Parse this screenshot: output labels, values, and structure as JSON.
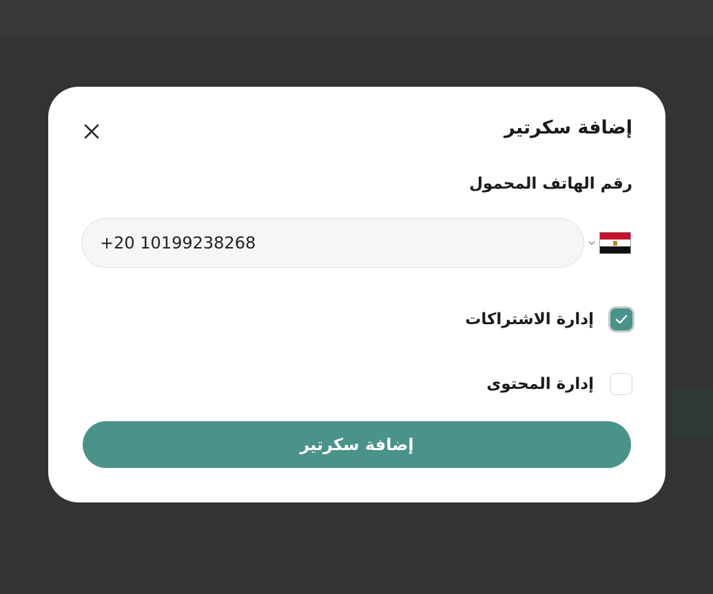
{
  "modal": {
    "title": "إضافة سكرتير",
    "phone_label": "رقم الهاتف المحمول",
    "phone_value": "+20 10199238268",
    "country": "Egypt",
    "permissions": [
      {
        "label": "إدارة الاشتراكات",
        "checked": true
      },
      {
        "label": "إدارة المحتوى",
        "checked": false
      }
    ],
    "submit_label": "إضافة سكرتير"
  },
  "colors": {
    "accent": "#4a938a",
    "overlay": "#333333"
  }
}
